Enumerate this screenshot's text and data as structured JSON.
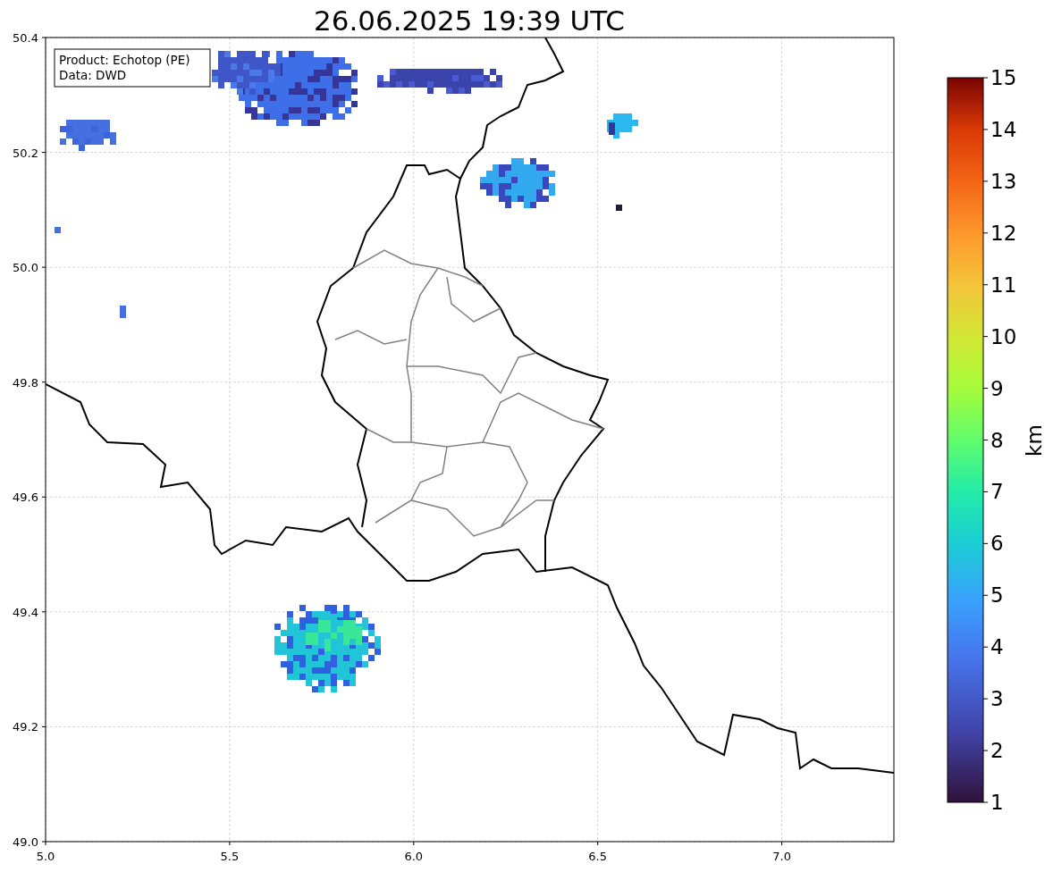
{
  "title": "26.06.2025 19:39 UTC",
  "info_box": {
    "lines": [
      "Product: Echotop (PE)",
      "Data: DWD"
    ]
  },
  "x_ticks": [
    "5.0",
    "5.5",
    "6.0",
    "6.5",
    "7.0"
  ],
  "y_ticks": [
    "50.4",
    "50.2",
    "50.0",
    "49.8",
    "49.6",
    "49.4",
    "49.2",
    "49.0"
  ],
  "colorbar": {
    "label": "km",
    "ticks": [
      "15",
      "14",
      "13",
      "12",
      "11",
      "10",
      "9",
      "8",
      "7",
      "6",
      "5",
      "4",
      "3",
      "2",
      "1"
    ]
  }
}
